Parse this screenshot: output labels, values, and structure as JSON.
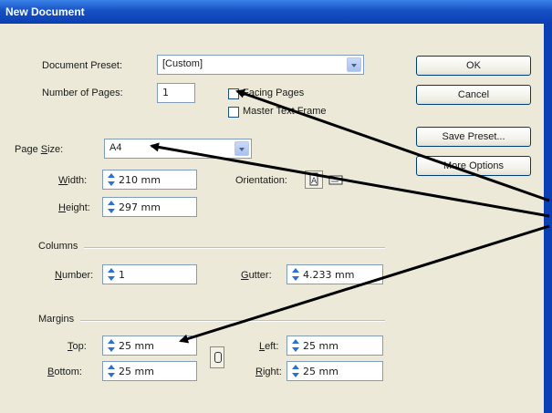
{
  "window": {
    "title": "New Document"
  },
  "document_preset": {
    "label": "Document Preset:",
    "value": "[Custom]"
  },
  "number_of_pages": {
    "label": "Number of Pages:",
    "value": "1"
  },
  "facing_pages": {
    "label": "Facing Pages",
    "checked": false
  },
  "master_text_frame": {
    "label": "Master Text Frame",
    "checked": false
  },
  "page_size": {
    "label_pre": "Page ",
    "label_u": "S",
    "label_post": "ize:",
    "value": "A4"
  },
  "width": {
    "label_u": "W",
    "label_post": "idth:",
    "value": "210 mm"
  },
  "height": {
    "label_u": "H",
    "label_post": "eight:",
    "value": "297 mm"
  },
  "orientation": {
    "label": "Orientation:",
    "portrait_icon": "portrait-orientation-icon",
    "landscape_icon": "landscape-orientation-icon"
  },
  "columns": {
    "section_label": "Columns",
    "number_label_u": "N",
    "number_label_post": "umber:",
    "number_value": "1",
    "gutter_label_u": "G",
    "gutter_label_post": "utter:",
    "gutter_value": "4.233 mm"
  },
  "margins": {
    "section_label": "Margins",
    "top_label_u": "T",
    "top_label_post": "op:",
    "top_value": "25 mm",
    "bottom_label_u": "B",
    "bottom_label_post": "ottom:",
    "bottom_value": "25 mm",
    "left_label_u": "L",
    "left_label_post": "eft:",
    "left_value": "25 mm",
    "right_label_u": "R",
    "right_label_post": "ight:",
    "right_value": "25 mm",
    "link_icon": "chain-link-icon"
  },
  "buttons": {
    "ok": "OK",
    "cancel": "Cancel",
    "save_preset": "Save Preset...",
    "more_options": "More Options"
  },
  "annotation": {
    "arrow_color": "#000000"
  },
  "colors": {
    "titlebar": "#0b3fb4",
    "dialog_bg": "#ece9d8",
    "spinner_arrow": "#2b6fd8"
  }
}
